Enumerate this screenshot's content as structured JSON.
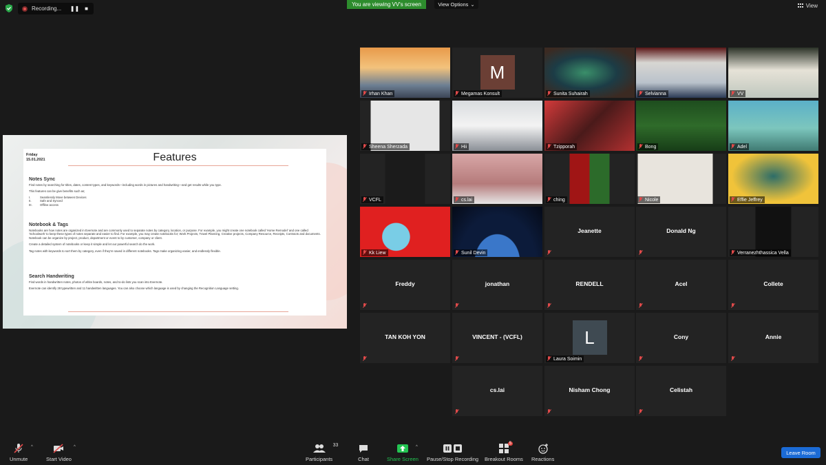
{
  "top_bar": {
    "recording_label": "Recording...",
    "viewing_banner": "You are viewing VV's screen",
    "view_options_label": "View Options",
    "view_label": "View"
  },
  "slide": {
    "date_day": "Friday",
    "date": "15.01.2021",
    "title": "Features",
    "sections": [
      {
        "heading": "Notes Sync",
        "paras": [
          "Find notes by searching for titles, dates, content types, and keywords—including words in pictures and handwriting—and get results while you type.",
          "This features can be give benefits such as;"
        ],
        "list": [
          {
            "n": "I.",
            "t": "Seamlessly Move between Devices"
          },
          {
            "n": "II.",
            "t": "Safe and Synced"
          },
          {
            "n": "III.",
            "t": "Offline access"
          }
        ]
      },
      {
        "heading": "Notebook & Tags",
        "paras": [
          "Notebooks are how notes are organized in Evernote and are commonly used to separate notes by category, location, or purpose. For example, you might create one notebook called 'Home Remodel' and one called 'Schoolwork' to keep these types of notes separate and easier to find. For example, you may create notebooks for; Work Projects, Travel Planning, Creative projects, Company Resource, Receipts, Contracts and documents. Notebook can be organize by project, product, department or event to by customer, company or client.",
          "Create a detailed system of notebooks or keep it simple and let our powerful search do the work.",
          "Tag notes with keywords to sort them by category, even if they're saved in different notebooks. Tags make organizing easier, and endlessly flexible."
        ],
        "list": []
      },
      {
        "heading": "Search Handwriting",
        "paras": [
          "Find words in handwritten notes, photos of white boards, notes, and to-do lists you scan into Evernote.",
          "Evernote can identify 28 typewritten and 11 handwritten languages. You can also choose which language is used by changing the Recognition Language setting."
        ],
        "list": []
      }
    ]
  },
  "participants_grid": [
    {
      "name": "Irhan Khan",
      "video": "bridge"
    },
    {
      "name": "Megamas Konsult",
      "video": "avatar",
      "initial": "M",
      "avatar_color": "#6b3f35"
    },
    {
      "name": "Sunita Suhairah",
      "video": "aurora-tv"
    },
    {
      "name": "Selvianna",
      "video": "window"
    },
    {
      "name": "VV",
      "video": "room"
    },
    {
      "name": "Sheena Sherzada",
      "video": "white-room"
    },
    {
      "name": "Hii",
      "video": "office"
    },
    {
      "name": "Tzipporah",
      "video": "neon"
    },
    {
      "name": "Bong",
      "video": "jungle"
    },
    {
      "name": "Adel",
      "video": "cartoon"
    },
    {
      "name": "VCFL",
      "video": "poster"
    },
    {
      "name": "cs.lai",
      "video": "desk"
    },
    {
      "name": "ching",
      "video": "stadium"
    },
    {
      "name": "Nicole",
      "video": "shelf"
    },
    {
      "name": "Effie Jeffrey",
      "video": "emoji"
    },
    {
      "name": "Kk Liew",
      "video": "red-cartoon"
    },
    {
      "name": "Sunil Devin",
      "video": "space"
    },
    {
      "name": "Jeanette",
      "video": "none"
    },
    {
      "name": "Donald Ng",
      "video": "none"
    },
    {
      "name": "Verranezhthassica Vella",
      "video": "black",
      "active": true
    },
    {
      "name": "Freddy",
      "video": "none"
    },
    {
      "name": "jonathan",
      "video": "none"
    },
    {
      "name": "RENDELL",
      "video": "none"
    },
    {
      "name": "Acel",
      "video": "none"
    },
    {
      "name": "Collete",
      "video": "none"
    },
    {
      "name": "TAN KOH YON",
      "video": "none"
    },
    {
      "name": "VINCENT - (VCFL)",
      "video": "none"
    },
    {
      "name": "Laura Soimin",
      "video": "avatar",
      "initial": "L",
      "avatar_color": "#3f4a52"
    },
    {
      "name": "Cony",
      "video": "none"
    },
    {
      "name": "Annie",
      "video": "none"
    },
    {
      "name": "cs.lai",
      "video": "none"
    },
    {
      "name": "Nisham Chong",
      "video": "none"
    },
    {
      "name": "Celistah",
      "video": "none"
    }
  ],
  "toolbar": {
    "unmute": "Unmute",
    "start_video": "Start Video",
    "participants": "Participants",
    "participants_count": "33",
    "chat": "Chat",
    "share_screen": "Share Screen",
    "pause_recording": "Pause/Stop Recording",
    "breakout_rooms": "Breakout Rooms",
    "breakout_badge": "5",
    "reactions": "Reactions",
    "leave_room": "Leave Room"
  },
  "colors": {
    "background": "#1a1a1a",
    "tile": "#232323",
    "viewing_banner": "#2d8c2d",
    "share_screen": "#23c552",
    "leave_button": "#1b6bd6",
    "muted_icon": "#e04a4a",
    "active_speaker_border": "#d9d98a"
  }
}
